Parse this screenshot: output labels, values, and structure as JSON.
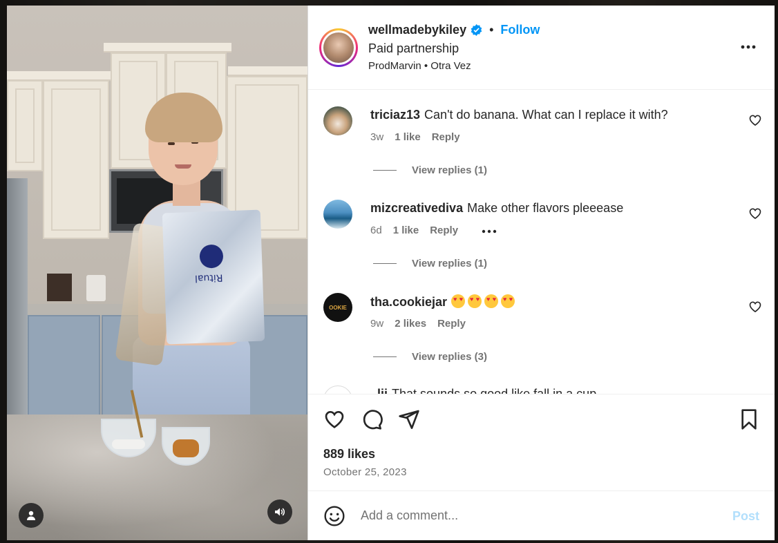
{
  "post": {
    "username": "wellmadebykiley",
    "follow_label": "Follow",
    "separator": "•",
    "subtitle": "Paid partnership",
    "audio": "ProdMarvin • Otra Vez",
    "more_icon": "more-horizontal-icon",
    "video_brand_text": "Ritual"
  },
  "comments": [
    {
      "username": "triciaz13",
      "text": "Can't do banana. What can I replace it with?",
      "age": "3w",
      "likes": "1 like",
      "reply": "Reply",
      "view_replies": "View replies (1)"
    },
    {
      "username": "mizcreativediva",
      "text": "Make other flavors pleeease",
      "age": "6d",
      "likes": "1 like",
      "reply": "Reply",
      "view_replies": "View replies (1)"
    },
    {
      "username": "tha.cookiejar",
      "text": "",
      "emoji_count": 4,
      "emoji_name": "heart-eyes-emoji",
      "age": "9w",
      "likes": "2 likes",
      "reply": "Reply",
      "view_replies": "View replies (3)",
      "avatar_text": "OOKIE"
    }
  ],
  "partial_comment": {
    "username": "..lii",
    "text": "That sounds so good like fall in a cup"
  },
  "stats": {
    "likes": "889 likes",
    "date": "October 25, 2023"
  },
  "add_comment": {
    "placeholder": "Add a comment...",
    "post_label": "Post"
  },
  "colors": {
    "accent": "#0095f6",
    "post_disabled": "#b2dffc",
    "text": "#262626",
    "secondary": "#737373"
  }
}
